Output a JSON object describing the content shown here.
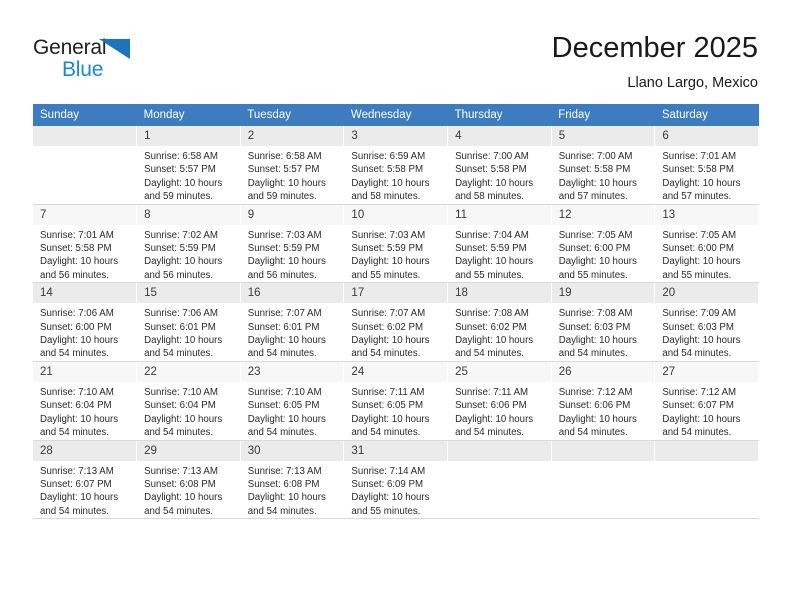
{
  "brand": {
    "name_part1": "General",
    "name_part2": "Blue",
    "logo_icon": "triangle-logo-icon",
    "color_dark": "#231f20",
    "color_blue": "#1b87d6",
    "triangle_color": "#1b75bb"
  },
  "header": {
    "title": "December 2025",
    "location": "Llano Largo, Mexico"
  },
  "theme": {
    "header_bar": "#3c7cbf",
    "row_shade": "#ebebeb",
    "row_plain": "#f7f7f7",
    "grid_line": "#d9d9d9"
  },
  "weekdays": [
    "Sunday",
    "Monday",
    "Tuesday",
    "Wednesday",
    "Thursday",
    "Friday",
    "Saturday"
  ],
  "weeks": [
    {
      "shaded": true,
      "days": [
        {
          "num": "",
          "sunrise": "",
          "sunset": "",
          "daylight1": "",
          "daylight2": ""
        },
        {
          "num": "1",
          "sunrise": "Sunrise: 6:58 AM",
          "sunset": "Sunset: 5:57 PM",
          "daylight1": "Daylight: 10 hours",
          "daylight2": "and 59 minutes."
        },
        {
          "num": "2",
          "sunrise": "Sunrise: 6:58 AM",
          "sunset": "Sunset: 5:57 PM",
          "daylight1": "Daylight: 10 hours",
          "daylight2": "and 59 minutes."
        },
        {
          "num": "3",
          "sunrise": "Sunrise: 6:59 AM",
          "sunset": "Sunset: 5:58 PM",
          "daylight1": "Daylight: 10 hours",
          "daylight2": "and 58 minutes."
        },
        {
          "num": "4",
          "sunrise": "Sunrise: 7:00 AM",
          "sunset": "Sunset: 5:58 PM",
          "daylight1": "Daylight: 10 hours",
          "daylight2": "and 58 minutes."
        },
        {
          "num": "5",
          "sunrise": "Sunrise: 7:00 AM",
          "sunset": "Sunset: 5:58 PM",
          "daylight1": "Daylight: 10 hours",
          "daylight2": "and 57 minutes."
        },
        {
          "num": "6",
          "sunrise": "Sunrise: 7:01 AM",
          "sunset": "Sunset: 5:58 PM",
          "daylight1": "Daylight: 10 hours",
          "daylight2": "and 57 minutes."
        }
      ]
    },
    {
      "shaded": false,
      "days": [
        {
          "num": "7",
          "sunrise": "Sunrise: 7:01 AM",
          "sunset": "Sunset: 5:58 PM",
          "daylight1": "Daylight: 10 hours",
          "daylight2": "and 56 minutes."
        },
        {
          "num": "8",
          "sunrise": "Sunrise: 7:02 AM",
          "sunset": "Sunset: 5:59 PM",
          "daylight1": "Daylight: 10 hours",
          "daylight2": "and 56 minutes."
        },
        {
          "num": "9",
          "sunrise": "Sunrise: 7:03 AM",
          "sunset": "Sunset: 5:59 PM",
          "daylight1": "Daylight: 10 hours",
          "daylight2": "and 56 minutes."
        },
        {
          "num": "10",
          "sunrise": "Sunrise: 7:03 AM",
          "sunset": "Sunset: 5:59 PM",
          "daylight1": "Daylight: 10 hours",
          "daylight2": "and 55 minutes."
        },
        {
          "num": "11",
          "sunrise": "Sunrise: 7:04 AM",
          "sunset": "Sunset: 5:59 PM",
          "daylight1": "Daylight: 10 hours",
          "daylight2": "and 55 minutes."
        },
        {
          "num": "12",
          "sunrise": "Sunrise: 7:05 AM",
          "sunset": "Sunset: 6:00 PM",
          "daylight1": "Daylight: 10 hours",
          "daylight2": "and 55 minutes."
        },
        {
          "num": "13",
          "sunrise": "Sunrise: 7:05 AM",
          "sunset": "Sunset: 6:00 PM",
          "daylight1": "Daylight: 10 hours",
          "daylight2": "and 55 minutes."
        }
      ]
    },
    {
      "shaded": true,
      "days": [
        {
          "num": "14",
          "sunrise": "Sunrise: 7:06 AM",
          "sunset": "Sunset: 6:00 PM",
          "daylight1": "Daylight: 10 hours",
          "daylight2": "and 54 minutes."
        },
        {
          "num": "15",
          "sunrise": "Sunrise: 7:06 AM",
          "sunset": "Sunset: 6:01 PM",
          "daylight1": "Daylight: 10 hours",
          "daylight2": "and 54 minutes."
        },
        {
          "num": "16",
          "sunrise": "Sunrise: 7:07 AM",
          "sunset": "Sunset: 6:01 PM",
          "daylight1": "Daylight: 10 hours",
          "daylight2": "and 54 minutes."
        },
        {
          "num": "17",
          "sunrise": "Sunrise: 7:07 AM",
          "sunset": "Sunset: 6:02 PM",
          "daylight1": "Daylight: 10 hours",
          "daylight2": "and 54 minutes."
        },
        {
          "num": "18",
          "sunrise": "Sunrise: 7:08 AM",
          "sunset": "Sunset: 6:02 PM",
          "daylight1": "Daylight: 10 hours",
          "daylight2": "and 54 minutes."
        },
        {
          "num": "19",
          "sunrise": "Sunrise: 7:08 AM",
          "sunset": "Sunset: 6:03 PM",
          "daylight1": "Daylight: 10 hours",
          "daylight2": "and 54 minutes."
        },
        {
          "num": "20",
          "sunrise": "Sunrise: 7:09 AM",
          "sunset": "Sunset: 6:03 PM",
          "daylight1": "Daylight: 10 hours",
          "daylight2": "and 54 minutes."
        }
      ]
    },
    {
      "shaded": false,
      "days": [
        {
          "num": "21",
          "sunrise": "Sunrise: 7:10 AM",
          "sunset": "Sunset: 6:04 PM",
          "daylight1": "Daylight: 10 hours",
          "daylight2": "and 54 minutes."
        },
        {
          "num": "22",
          "sunrise": "Sunrise: 7:10 AM",
          "sunset": "Sunset: 6:04 PM",
          "daylight1": "Daylight: 10 hours",
          "daylight2": "and 54 minutes."
        },
        {
          "num": "23",
          "sunrise": "Sunrise: 7:10 AM",
          "sunset": "Sunset: 6:05 PM",
          "daylight1": "Daylight: 10 hours",
          "daylight2": "and 54 minutes."
        },
        {
          "num": "24",
          "sunrise": "Sunrise: 7:11 AM",
          "sunset": "Sunset: 6:05 PM",
          "daylight1": "Daylight: 10 hours",
          "daylight2": "and 54 minutes."
        },
        {
          "num": "25",
          "sunrise": "Sunrise: 7:11 AM",
          "sunset": "Sunset: 6:06 PM",
          "daylight1": "Daylight: 10 hours",
          "daylight2": "and 54 minutes."
        },
        {
          "num": "26",
          "sunrise": "Sunrise: 7:12 AM",
          "sunset": "Sunset: 6:06 PM",
          "daylight1": "Daylight: 10 hours",
          "daylight2": "and 54 minutes."
        },
        {
          "num": "27",
          "sunrise": "Sunrise: 7:12 AM",
          "sunset": "Sunset: 6:07 PM",
          "daylight1": "Daylight: 10 hours",
          "daylight2": "and 54 minutes."
        }
      ]
    },
    {
      "shaded": true,
      "days": [
        {
          "num": "28",
          "sunrise": "Sunrise: 7:13 AM",
          "sunset": "Sunset: 6:07 PM",
          "daylight1": "Daylight: 10 hours",
          "daylight2": "and 54 minutes."
        },
        {
          "num": "29",
          "sunrise": "Sunrise: 7:13 AM",
          "sunset": "Sunset: 6:08 PM",
          "daylight1": "Daylight: 10 hours",
          "daylight2": "and 54 minutes."
        },
        {
          "num": "30",
          "sunrise": "Sunrise: 7:13 AM",
          "sunset": "Sunset: 6:08 PM",
          "daylight1": "Daylight: 10 hours",
          "daylight2": "and 54 minutes."
        },
        {
          "num": "31",
          "sunrise": "Sunrise: 7:14 AM",
          "sunset": "Sunset: 6:09 PM",
          "daylight1": "Daylight: 10 hours",
          "daylight2": "and 55 minutes."
        },
        {
          "num": "",
          "sunrise": "",
          "sunset": "",
          "daylight1": "",
          "daylight2": ""
        },
        {
          "num": "",
          "sunrise": "",
          "sunset": "",
          "daylight1": "",
          "daylight2": ""
        },
        {
          "num": "",
          "sunrise": "",
          "sunset": "",
          "daylight1": "",
          "daylight2": ""
        }
      ]
    }
  ]
}
